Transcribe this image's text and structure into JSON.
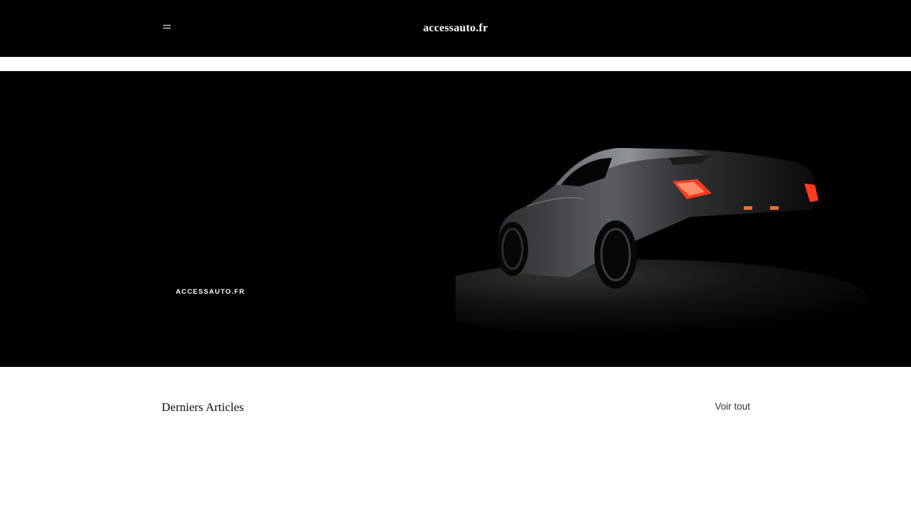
{
  "header": {
    "logo": "accessauto.fr",
    "menu_icon": "hamburger-menu-icon"
  },
  "hero": {
    "tagline": "ACCESSAUTO.FR",
    "image": "dark-sports-car-rear-view"
  },
  "articles": {
    "title": "Derniers Articles",
    "see_all": "Voir tout"
  },
  "colors": {
    "header_bg": "#000000",
    "hero_bg": "#000000",
    "page_bg": "#ffffff",
    "taillight": "#ff3a1e"
  }
}
